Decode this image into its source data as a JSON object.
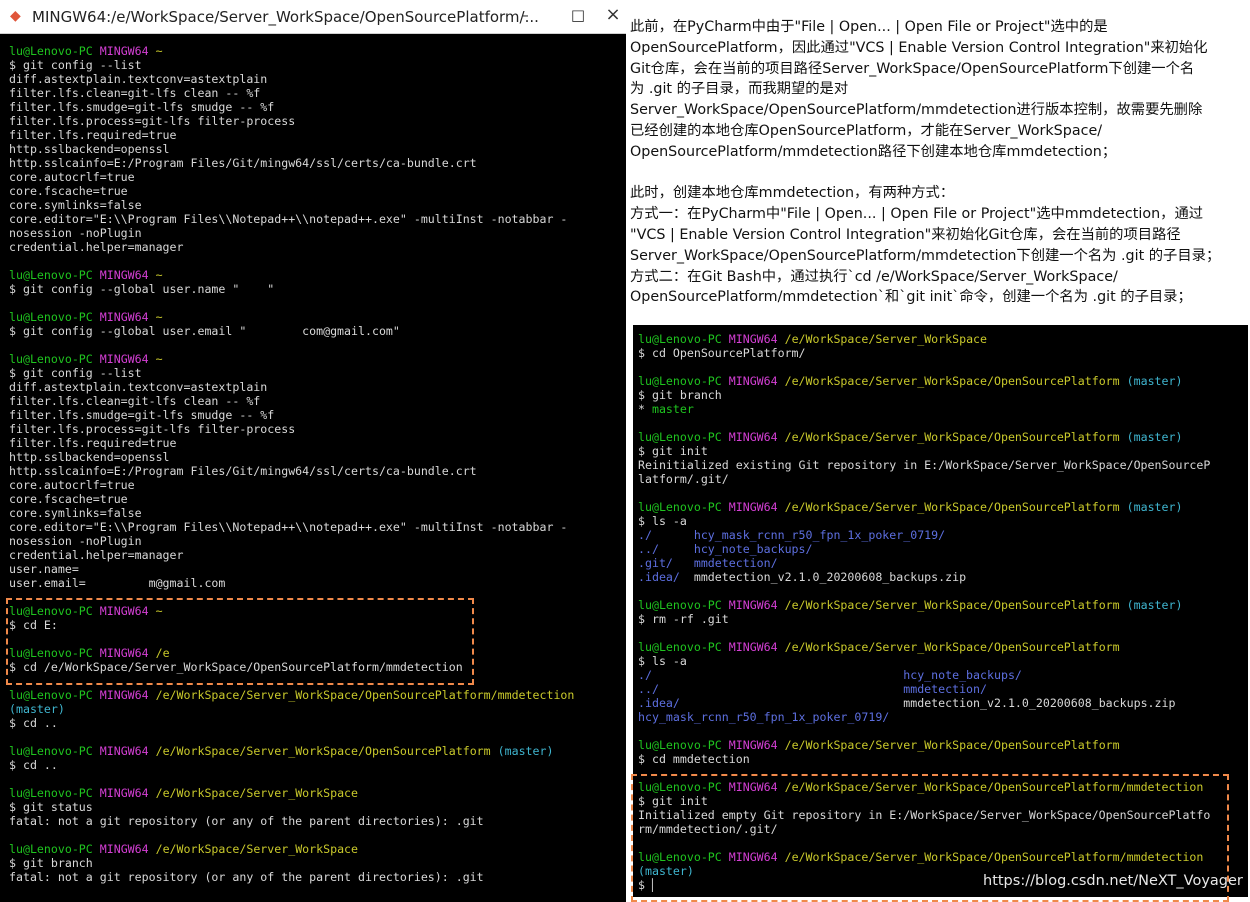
{
  "window": {
    "title": "MINGW64:/e/WorkSpace/Server_WorkSpace/OpenSourcePlatform/...",
    "icon": "mingw-icon",
    "controls": {
      "minimize": "–",
      "maximize": "□",
      "close": "×"
    }
  },
  "left_terminal": [
    [
      [
        "g",
        "lu@Lenovo-PC "
      ],
      [
        "m",
        "MINGW64 "
      ],
      [
        "y",
        "~"
      ]
    ],
    [
      [
        "w",
        "$ git config --list"
      ]
    ],
    [
      [
        "w",
        "diff.astextplain.textconv=astextplain"
      ]
    ],
    [
      [
        "w",
        "filter.lfs.clean=git-lfs clean -- %f"
      ]
    ],
    [
      [
        "w",
        "filter.lfs.smudge=git-lfs smudge -- %f"
      ]
    ],
    [
      [
        "w",
        "filter.lfs.process=git-lfs filter-process"
      ]
    ],
    [
      [
        "w",
        "filter.lfs.required=true"
      ]
    ],
    [
      [
        "w",
        "http.sslbackend=openssl"
      ]
    ],
    [
      [
        "w",
        "http.sslcainfo=E:/Program Files/Git/mingw64/ssl/certs/ca-bundle.crt"
      ]
    ],
    [
      [
        "w",
        "core.autocrlf=true"
      ]
    ],
    [
      [
        "w",
        "core.fscache=true"
      ]
    ],
    [
      [
        "w",
        "core.symlinks=false"
      ]
    ],
    [
      [
        "w",
        "core.editor=\"E:\\\\Program Files\\\\Notepad++\\\\notepad++.exe\" -multiInst -notabbar -"
      ]
    ],
    [
      [
        "w",
        "nosession -noPlugin"
      ]
    ],
    [
      [
        "w",
        "credential.helper=manager"
      ]
    ],
    [],
    [
      [
        "g",
        "lu@Lenovo-PC "
      ],
      [
        "m",
        "MINGW64 "
      ],
      [
        "y",
        "~"
      ]
    ],
    [
      [
        "w",
        "$ git config --global user.name \"    \""
      ]
    ],
    [],
    [
      [
        "g",
        "lu@Lenovo-PC "
      ],
      [
        "m",
        "MINGW64 "
      ],
      [
        "y",
        "~"
      ]
    ],
    [
      [
        "w",
        "$ git config --global user.email \"        com@gmail.com\""
      ]
    ],
    [],
    [
      [
        "g",
        "lu@Lenovo-PC "
      ],
      [
        "m",
        "MINGW64 "
      ],
      [
        "y",
        "~"
      ]
    ],
    [
      [
        "w",
        "$ git config --list"
      ]
    ],
    [
      [
        "w",
        "diff.astextplain.textconv=astextplain"
      ]
    ],
    [
      [
        "w",
        "filter.lfs.clean=git-lfs clean -- %f"
      ]
    ],
    [
      [
        "w",
        "filter.lfs.smudge=git-lfs smudge -- %f"
      ]
    ],
    [
      [
        "w",
        "filter.lfs.process=git-lfs filter-process"
      ]
    ],
    [
      [
        "w",
        "filter.lfs.required=true"
      ]
    ],
    [
      [
        "w",
        "http.sslbackend=openssl"
      ]
    ],
    [
      [
        "w",
        "http.sslcainfo=E:/Program Files/Git/mingw64/ssl/certs/ca-bundle.crt"
      ]
    ],
    [
      [
        "w",
        "core.autocrlf=true"
      ]
    ],
    [
      [
        "w",
        "core.fscache=true"
      ]
    ],
    [
      [
        "w",
        "core.symlinks=false"
      ]
    ],
    [
      [
        "w",
        "core.editor=\"E:\\\\Program Files\\\\Notepad++\\\\notepad++.exe\" -multiInst -notabbar -"
      ]
    ],
    [
      [
        "w",
        "nosession -noPlugin"
      ]
    ],
    [
      [
        "w",
        "credential.helper=manager"
      ]
    ],
    [
      [
        "w",
        "user.name="
      ]
    ],
    [
      [
        "w",
        "user.email=         m@gmail.com"
      ]
    ],
    [],
    [
      [
        "g",
        "lu@Lenovo-PC "
      ],
      [
        "m",
        "MINGW64 "
      ],
      [
        "y",
        "~"
      ]
    ],
    [
      [
        "w",
        "$ cd E:"
      ]
    ],
    [],
    [
      [
        "g",
        "lu@Lenovo-PC "
      ],
      [
        "m",
        "MINGW64 "
      ],
      [
        "y",
        "/e"
      ]
    ],
    [
      [
        "w",
        "$ cd /e/WorkSpace/Server_WorkSpace/OpenSourcePlatform/mmdetection"
      ]
    ],
    [],
    [
      [
        "g",
        "lu@Lenovo-PC "
      ],
      [
        "m",
        "MINGW64 "
      ],
      [
        "y",
        "/e/WorkSpace/Server_WorkSpace/OpenSourcePlatform/mmdetection"
      ]
    ],
    [
      [
        "c",
        "(master)"
      ]
    ],
    [
      [
        "w",
        "$ cd .."
      ]
    ],
    [],
    [
      [
        "g",
        "lu@Lenovo-PC "
      ],
      [
        "m",
        "MINGW64 "
      ],
      [
        "y",
        "/e/WorkSpace/Server_WorkSpace/OpenSourcePlatform "
      ],
      [
        "c",
        "(master)"
      ]
    ],
    [
      [
        "w",
        "$ cd .."
      ]
    ],
    [],
    [
      [
        "g",
        "lu@Lenovo-PC "
      ],
      [
        "m",
        "MINGW64 "
      ],
      [
        "y",
        "/e/WorkSpace/Server_WorkSpace"
      ]
    ],
    [
      [
        "w",
        "$ git status"
      ]
    ],
    [
      [
        "w",
        "fatal: not a git repository (or any of the parent directories): .git"
      ]
    ],
    [],
    [
      [
        "g",
        "lu@Lenovo-PC "
      ],
      [
        "m",
        "MINGW64 "
      ],
      [
        "y",
        "/e/WorkSpace/Server_WorkSpace"
      ]
    ],
    [
      [
        "w",
        "$ git branch"
      ]
    ],
    [
      [
        "w",
        "fatal: not a git repository (or any of the parent directories): .git"
      ]
    ]
  ],
  "notes": [
    "此前，在PyCharm中由于\"File | Open... | Open File or Project\"选中的是",
    "OpenSourcePlatform，因此通过\"VCS | Enable Version Control Integration\"来初始化",
    "Git仓库，会在当前的项目路径Server_WorkSpace/OpenSourcePlatform下创建一个名",
    "为 .git 的子目录，而我期望的是对",
    "Server_WorkSpace/OpenSourcePlatform/mmdetection进行版本控制，故需要先删除",
    "已经创建的本地仓库OpenSourcePlatform，才能在Server_WorkSpace/",
    "OpenSourcePlatform/mmdetection路径下创建本地仓库mmdetection；",
    "",
    "此时，创建本地仓库mmdetection，有两种方式：",
    "方式一：在PyCharm中\"File | Open... | Open File or Project\"选中mmdetection，通过",
    "\"VCS | Enable Version Control Integration\"来初始化Git仓库，会在当前的项目路径",
    "Server_WorkSpace/OpenSourcePlatform/mmdetection下创建一个名为 .git 的子目录；",
    "方式二：在Git Bash中，通过执行`cd /e/WorkSpace/Server_WorkSpace/",
    "OpenSourcePlatform/mmdetection`和`git init`命令，创建一个名为 .git 的子目录；"
  ],
  "right_terminal": [
    [
      [
        "g",
        "lu@Lenovo-PC "
      ],
      [
        "m",
        "MINGW64 "
      ],
      [
        "y",
        "/e/WorkSpace/Server_WorkSpace"
      ]
    ],
    [
      [
        "w",
        "$ cd OpenSourcePlatform/"
      ]
    ],
    [],
    [
      [
        "g",
        "lu@Lenovo-PC "
      ],
      [
        "m",
        "MINGW64 "
      ],
      [
        "y",
        "/e/WorkSpace/Server_WorkSpace/OpenSourcePlatform "
      ],
      [
        "c",
        "(master)"
      ]
    ],
    [
      [
        "w",
        "$ git branch"
      ]
    ],
    [
      [
        "w",
        "* "
      ],
      [
        "g",
        "master"
      ]
    ],
    [],
    [
      [
        "g",
        "lu@Lenovo-PC "
      ],
      [
        "m",
        "MINGW64 "
      ],
      [
        "y",
        "/e/WorkSpace/Server_WorkSpace/OpenSourcePlatform "
      ],
      [
        "c",
        "(master)"
      ]
    ],
    [
      [
        "w",
        "$ git init"
      ]
    ],
    [
      [
        "w",
        "Reinitialized existing Git repository in E:/WorkSpace/Server_WorkSpace/OpenSourceP"
      ]
    ],
    [
      [
        "w",
        "latform/.git/"
      ]
    ],
    [],
    [
      [
        "g",
        "lu@Lenovo-PC "
      ],
      [
        "m",
        "MINGW64 "
      ],
      [
        "y",
        "/e/WorkSpace/Server_WorkSpace/OpenSourcePlatform "
      ],
      [
        "c",
        "(master)"
      ]
    ],
    [
      [
        "w",
        "$ ls -a"
      ]
    ],
    [
      [
        "b",
        "./      hcy_mask_rcnn_r50_fpn_1x_poker_0719/"
      ]
    ],
    [
      [
        "b",
        "../     hcy_note_backups/"
      ]
    ],
    [
      [
        "b",
        ".git/   mmdetection/"
      ]
    ],
    [
      [
        "b",
        ".idea/  "
      ],
      [
        "w",
        "mmdetection_v2.1.0_20200608_backups.zip"
      ]
    ],
    [],
    [
      [
        "g",
        "lu@Lenovo-PC "
      ],
      [
        "m",
        "MINGW64 "
      ],
      [
        "y",
        "/e/WorkSpace/Server_WorkSpace/OpenSourcePlatform "
      ],
      [
        "c",
        "(master)"
      ]
    ],
    [
      [
        "w",
        "$ rm -rf .git"
      ]
    ],
    [],
    [
      [
        "g",
        "lu@Lenovo-PC "
      ],
      [
        "m",
        "MINGW64 "
      ],
      [
        "y",
        "/e/WorkSpace/Server_WorkSpace/OpenSourcePlatform"
      ]
    ],
    [
      [
        "w",
        "$ ls -a"
      ]
    ],
    [
      [
        "b",
        "./                                    hcy_note_backups/"
      ]
    ],
    [
      [
        "b",
        "../                                   mmdetection/"
      ]
    ],
    [
      [
        "b",
        ".idea/                                "
      ],
      [
        "w",
        "mmdetection_v2.1.0_20200608_backups.zip"
      ]
    ],
    [
      [
        "b",
        "hcy_mask_rcnn_r50_fpn_1x_poker_0719/"
      ]
    ],
    [],
    [
      [
        "g",
        "lu@Lenovo-PC "
      ],
      [
        "m",
        "MINGW64 "
      ],
      [
        "y",
        "/e/WorkSpace/Server_WorkSpace/OpenSourcePlatform"
      ]
    ],
    [
      [
        "w",
        "$ cd mmdetection"
      ]
    ],
    [],
    [
      [
        "g",
        "lu@Lenovo-PC "
      ],
      [
        "m",
        "MINGW64 "
      ],
      [
        "y",
        "/e/WorkSpace/Server_WorkSpace/OpenSourcePlatform/mmdetection"
      ]
    ],
    [
      [
        "w",
        "$ git init"
      ]
    ],
    [
      [
        "w",
        "Initialized empty Git repository in E:/WorkSpace/Server_WorkSpace/OpenSourcePlatfo"
      ]
    ],
    [
      [
        "w",
        "rm/mmdetection/.git/"
      ]
    ],
    [],
    [
      [
        "g",
        "lu@Lenovo-PC "
      ],
      [
        "m",
        "MINGW64 "
      ],
      [
        "y",
        "/e/WorkSpace/Server_WorkSpace/OpenSourcePlatform/mmdetection"
      ]
    ],
    [
      [
        "c",
        "(master)"
      ]
    ],
    [
      [
        "w",
        "$ ▏"
      ]
    ]
  ],
  "watermark": "https://blog.csdn.net/NeXT_Voyager",
  "colors": {
    "prompt_user": "#1fc41f",
    "prompt_host": "#d43fd4",
    "prompt_path": "#c9c92b",
    "branch": "#3fb5cf",
    "directory": "#5d6fe0",
    "highlight_border": "#f0894a"
  }
}
